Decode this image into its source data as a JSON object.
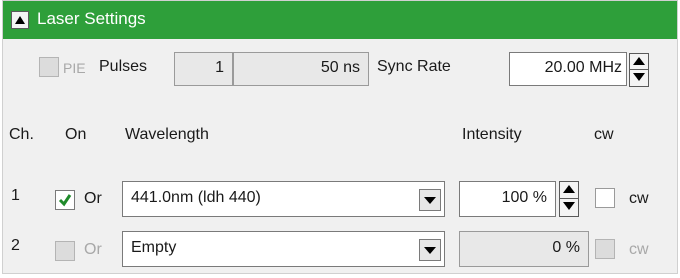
{
  "panel": {
    "title": "Laser Settings"
  },
  "top_row": {
    "pie_label": "PIE",
    "pie_checked": false,
    "pulses_label": "Pulses",
    "pulses_count": "1",
    "pulses_width": "50 ns",
    "sync_rate_label": "Sync Rate",
    "sync_rate_value": "20.00 MHz"
  },
  "columns": {
    "ch": "Ch.",
    "on": "On",
    "wavelength": "Wavelength",
    "intensity": "Intensity",
    "cw": "cw"
  },
  "channels": [
    {
      "number": "1",
      "on_checked": true,
      "or_label": "Or",
      "wavelength": "441.0nm (ldh 440)",
      "intensity": "100 %",
      "cw_label": "cw",
      "enabled": true
    },
    {
      "number": "2",
      "on_checked": false,
      "or_label": "Or",
      "wavelength": "Empty",
      "intensity": "0 %",
      "cw_label": "cw",
      "enabled": false
    }
  ],
  "colors": {
    "header_green": "#2e9f3a",
    "check_green": "#1f8a2a"
  },
  "icons": {
    "collapse": "triangle-up-icon",
    "spin_up": "spin-up-icon",
    "spin_down": "spin-down-icon",
    "dropdown": "chevron-down-icon",
    "checkmark": "checkmark-icon"
  }
}
